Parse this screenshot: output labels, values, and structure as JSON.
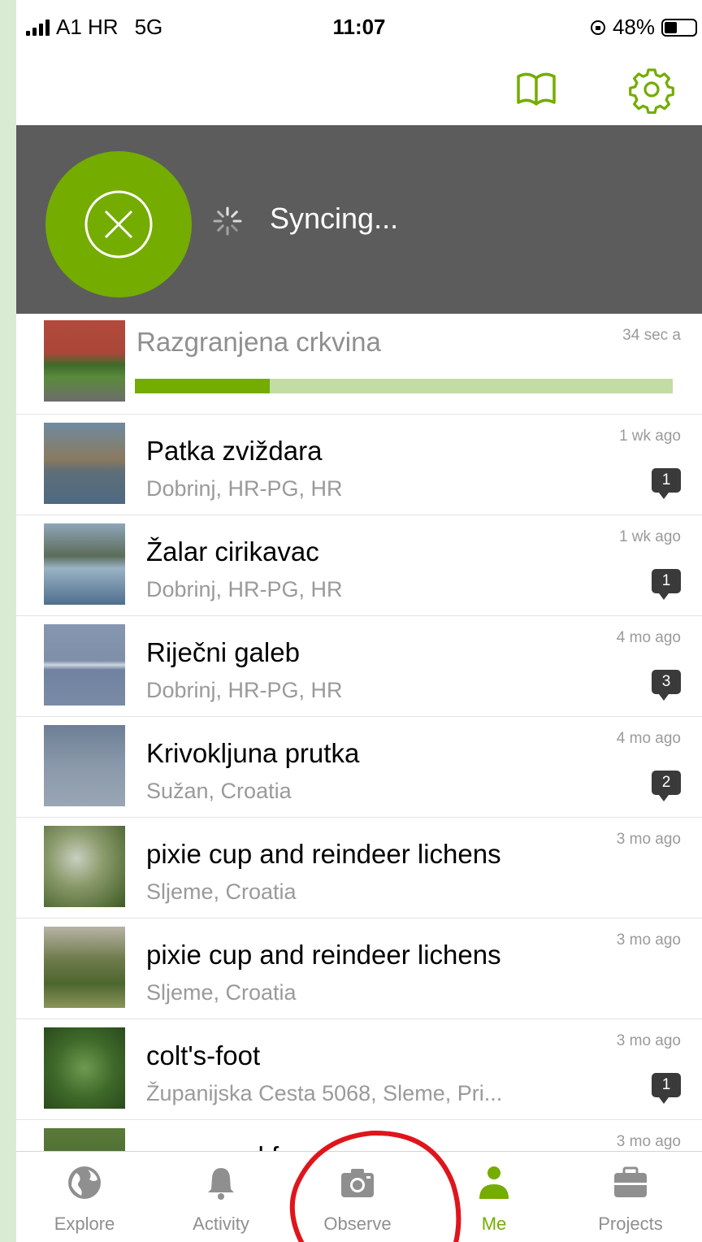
{
  "status_bar": {
    "carrier": "A1 HR",
    "network": "5G",
    "time": "11:07",
    "battery": "48%",
    "battery_level": 0.48
  },
  "header": {
    "guide_icon": "book-icon",
    "settings_icon": "gear-icon"
  },
  "sync": {
    "cancel_icon": "close-circle-icon",
    "status_text": "Syncing..."
  },
  "uploading": {
    "title": "Razgranjena crkvina",
    "time": "34 sec a",
    "progress": 0.25
  },
  "observations": [
    {
      "title": "Patka zviždara",
      "place": "Dobrinj, HR-PG, HR",
      "time": "1 wk ago",
      "comments": "1"
    },
    {
      "title": "Žalar cirikavac",
      "place": "Dobrinj, HR-PG, HR",
      "time": "1 wk ago",
      "comments": "1"
    },
    {
      "title": "Riječni galeb",
      "place": "Dobrinj, HR-PG, HR",
      "time": "4 mo ago",
      "comments": "3"
    },
    {
      "title": "Krivokljuna prutka",
      "place": "Sužan, Croatia",
      "time": "4 mo ago",
      "comments": "2"
    },
    {
      "title": "pixie cup and reindeer lichens",
      "place": "Sljeme, Croatia",
      "time": "3 mo ago",
      "comments": ""
    },
    {
      "title": "pixie cup and reindeer lichens",
      "place": "Sljeme, Croatia",
      "time": "3 mo ago",
      "comments": ""
    },
    {
      "title": "colt's-foot",
      "place": "Županijska Cesta 5068, Sleme, Pri...",
      "time": "3 mo ago",
      "comments": "1"
    },
    {
      "title": "grey coral fungus",
      "place": "",
      "time": "3 mo ago",
      "comments": ""
    }
  ],
  "tabs": [
    {
      "label": "Explore",
      "icon": "globe-icon"
    },
    {
      "label": "Activity",
      "icon": "bell-icon"
    },
    {
      "label": "Observe",
      "icon": "camera-icon"
    },
    {
      "label": "Me",
      "icon": "person-icon",
      "active": true
    },
    {
      "label": "Projects",
      "icon": "briefcase-icon"
    }
  ],
  "colors": {
    "brand_green": "#74ac00",
    "sync_bar": "#5c5c5c",
    "progress_track": "#c2dca4",
    "badge": "#3a3a3a",
    "annotation": "#e0151b"
  }
}
